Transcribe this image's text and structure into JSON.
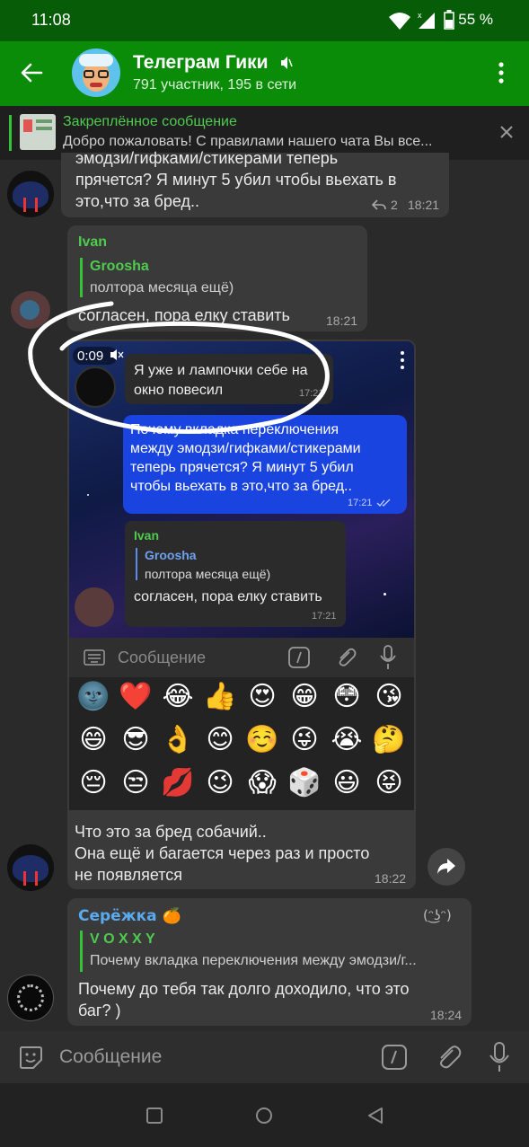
{
  "status_bar": {
    "time": "11:08",
    "battery": "55 %"
  },
  "header": {
    "title": "Телеграм Гики",
    "subtitle": "791 участник, 195 в сети"
  },
  "pinned": {
    "title": "Закреплённое сообщение",
    "text": "Добро пожаловать! С правилами нашего чата Вы все..."
  },
  "messages": [
    {
      "text_line0": "эмодзи/гифками/стикерами теперь",
      "text_line1": "прячется? Я минут 5 убил чтобы вьехать в",
      "text_line2": "это,что за бред..",
      "replies": "2",
      "time": "18:21"
    },
    {
      "sender": "Ivan",
      "quote_sender": "Groosha",
      "quote_text": "полтора месяца ещё)",
      "text": "согласен, пора елку ставить",
      "time": "18:21"
    },
    {
      "text_line1": "Что это за бред собачий..",
      "text_line2": "Она ещё и багается через раз и просто",
      "text_line3": "не появляется",
      "time": "18:22"
    },
    {
      "sender": "Серёжка 🍊",
      "sender_badge": "(ᵔ͜ʖᵔ)",
      "quote_sender": "V O X X Y",
      "quote_text": "Почему вкладка переключения между эмодзи/г...",
      "text_line1": "Почему до тебя так долго доходило, что это",
      "text_line2": "баг? )",
      "time": "18:24"
    }
  ],
  "embedded_screenshot": {
    "video_time": "0:09",
    "video_msg_line1": "Я уже и лампочки себе на",
    "video_msg_line2": "окно повесил",
    "video_msg_time": "17:21",
    "own_msg_line1": "Почему вкладка переключения",
    "own_msg_line2": "между эмодзи/гифками/стикерами",
    "own_msg_line3": "теперь прячется? Я минут 5 убил",
    "own_msg_line4": "чтобы вьехать в это,что за бред..",
    "own_msg_time": "17:21",
    "reply_sender": "Ivan",
    "reply_quote_sender": "Groosha",
    "reply_quote_text": "полтора месяца ещё)",
    "reply_text": "согласен, пора елку ставить",
    "reply_time": "17:21",
    "input_placeholder": "Сообщение",
    "emojis": [
      "🌚",
      "❤️",
      "😂",
      "👍",
      "😍",
      "😁",
      "😳",
      "😘",
      "😄",
      "😎",
      "👌",
      "😊",
      "☺️",
      "😜",
      "😭",
      "🤔",
      "😔",
      "😒",
      "💋",
      "😉",
      "😱",
      "🎲",
      "😃",
      "😝"
    ]
  },
  "input": {
    "placeholder": "Сообщение"
  },
  "colors": {
    "header": "#0a8c08",
    "status": "#075d07",
    "accent": "#35c335",
    "own_bubble": "#1a44e0"
  }
}
